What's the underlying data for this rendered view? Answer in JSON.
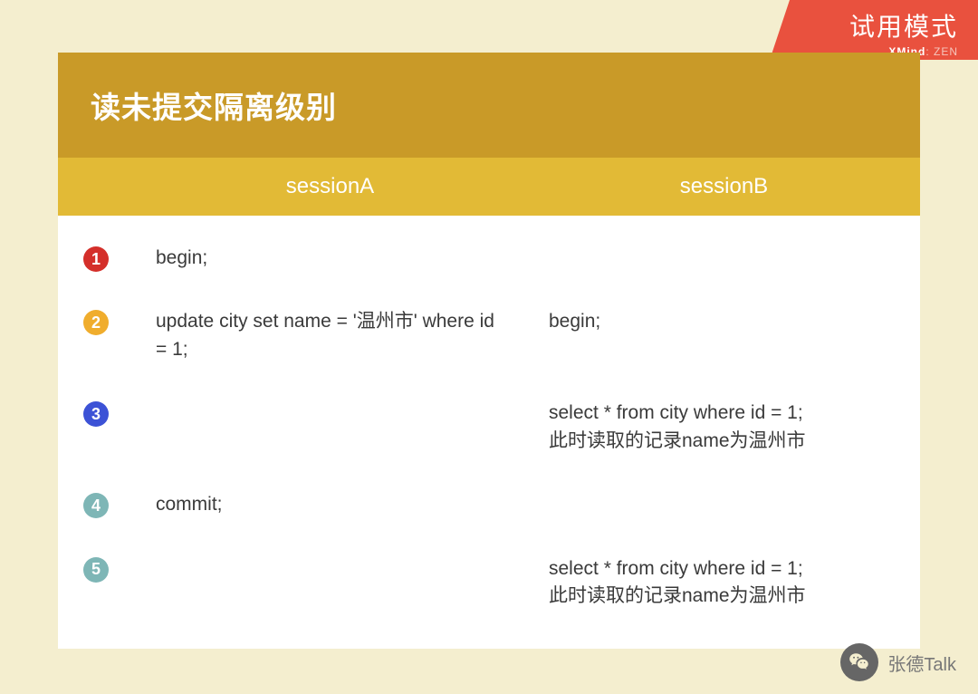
{
  "trial": {
    "title": "试用模式",
    "sub_brand": "XMind",
    "sub_suffix": ": ZEN"
  },
  "card": {
    "title": "读未提交隔离级别",
    "header": {
      "sessionA": "sessionA",
      "sessionB": "sessionB"
    },
    "steps": [
      {
        "num": "1",
        "badge": "b1",
        "sessionA": "begin;",
        "sessionB": ""
      },
      {
        "num": "2",
        "badge": "b2",
        "sessionA": "update city set name = '温州市' where id = 1;",
        "sessionB": "begin;"
      },
      {
        "num": "3",
        "badge": "b3",
        "sessionA": "",
        "sessionB": "select * from city where id = 1;\n此时读取的记录name为温州市"
      },
      {
        "num": "4",
        "badge": "b4",
        "sessionA": "commit;",
        "sessionB": ""
      },
      {
        "num": "5",
        "badge": "b5",
        "sessionA": "",
        "sessionB": "select * from city where id = 1;\n此时读取的记录name为温州市"
      }
    ]
  },
  "footer": {
    "author": "张德Talk"
  }
}
